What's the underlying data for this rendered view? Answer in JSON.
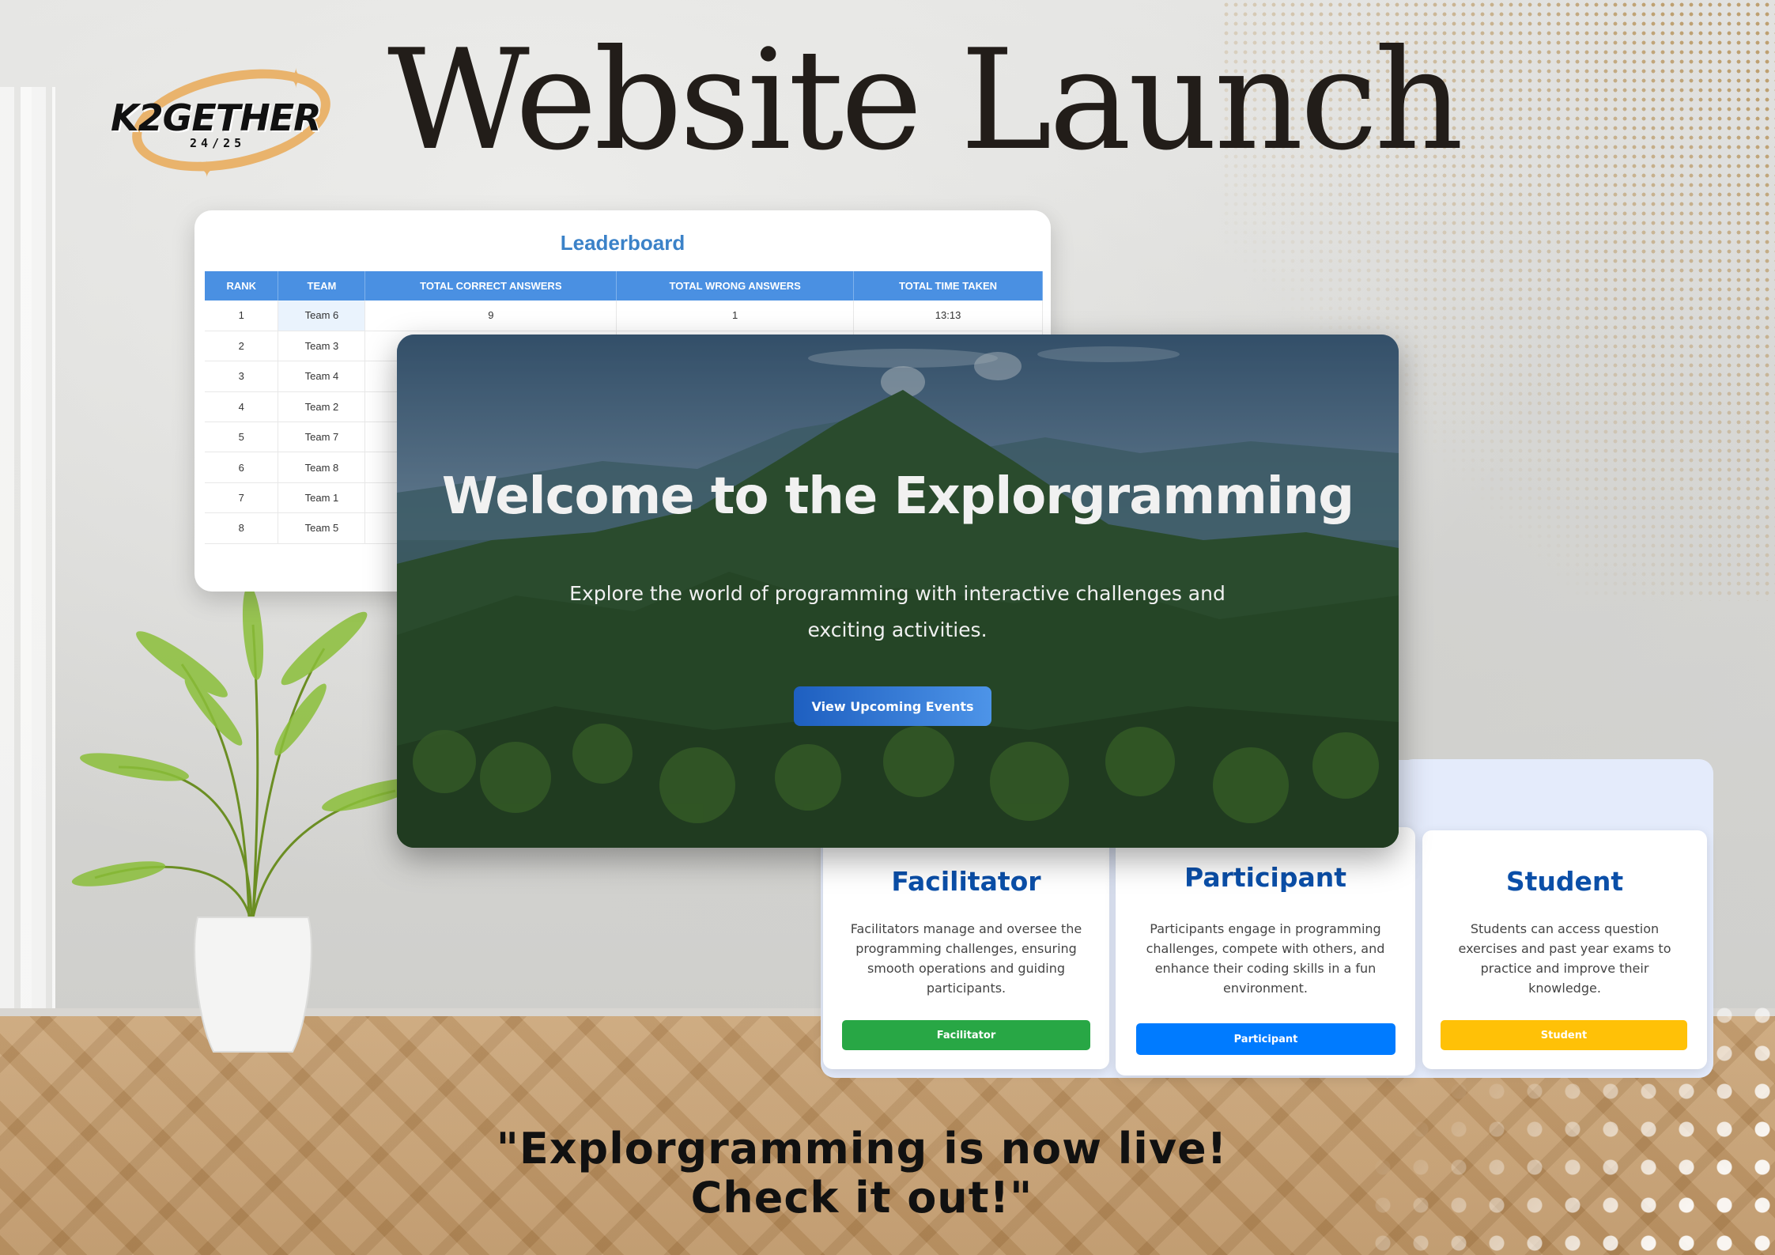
{
  "logo": {
    "text": "K2GETHER",
    "year": "24/25",
    "icon": "star-icon"
  },
  "headline": "Website Launch",
  "leaderboard": {
    "title": "Leaderboard",
    "columns": [
      "RANK",
      "TEAM",
      "TOTAL CORRECT ANSWERS",
      "TOTAL WRONG ANSWERS",
      "TOTAL TIME TAKEN"
    ],
    "rows": [
      {
        "rank": "1",
        "team": "Team 6",
        "correct": "9",
        "wrong": "1",
        "time": "13:13"
      },
      {
        "rank": "2",
        "team": "Team 3"
      },
      {
        "rank": "3",
        "team": "Team 4"
      },
      {
        "rank": "4",
        "team": "Team 2"
      },
      {
        "rank": "5",
        "team": "Team 7"
      },
      {
        "rank": "6",
        "team": "Team 8"
      },
      {
        "rank": "7",
        "team": "Team 1"
      },
      {
        "rank": "8",
        "team": "Team 5"
      }
    ]
  },
  "hero": {
    "title": "Welcome to the Explorgramming",
    "subtitle": "Explore the world of programming with interactive challenges and exciting activities.",
    "button": "View Upcoming Events"
  },
  "roles": [
    {
      "title": "Facilitator",
      "description": "Facilitators manage and oversee the programming challenges, ensuring smooth operations and guiding participants.",
      "button": "Facilitator",
      "color": "#28a745"
    },
    {
      "title": "Participant",
      "description": "Participants engage in programming challenges, compete with others, and enhance their coding skills in a fun environment.",
      "button": "Participant",
      "color": "#007bff"
    },
    {
      "title": "Student",
      "description": "Students can access question exercises and past year exams to practice and improve their knowledge.",
      "button": "Student",
      "color": "#ffc107"
    }
  ],
  "tagline": {
    "line1": "\"Explorgramming is now live!",
    "line2": "Check it out!\""
  },
  "colors": {
    "accent_blue": "#4a90e2",
    "title_blue": "#0b4fa8",
    "logo_gold": "#e9b36c"
  }
}
